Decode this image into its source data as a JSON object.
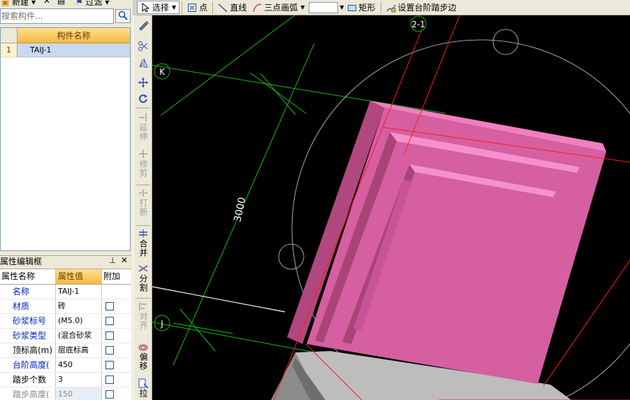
{
  "toolbar_left": {
    "new_label": "新建",
    "filter_label": "过滤"
  },
  "toolbar": {
    "select_label": "选择",
    "point_label": "点",
    "line_label": "直线",
    "arc_label": "三点画弧",
    "rect_label": "矩形",
    "step_label": "设置台阶踏步边"
  },
  "search": {
    "placeholder": "搜索构件..."
  },
  "component_list": {
    "header": "构件名称",
    "rows": [
      {
        "num": "1",
        "name": "TAIJ-1"
      }
    ]
  },
  "property_panel": {
    "title": "属性编辑框",
    "pin": "ㅁ",
    "close": "×",
    "headers": {
      "name": "属性名称",
      "value": "属性值",
      "attach": "附加"
    },
    "rows": [
      {
        "name": "名称",
        "value": "TAIJ-1",
        "style": "blue",
        "checkbox": false
      },
      {
        "name": "材质",
        "value": "砖",
        "style": "blue",
        "checkbox": true
      },
      {
        "name": "砂浆标号",
        "value": "(M5.0)",
        "style": "blue",
        "checkbox": true
      },
      {
        "name": "砂浆类型",
        "value": "(混合砂浆",
        "style": "blue",
        "checkbox": true
      },
      {
        "name": "顶标高(m)",
        "value": "层底标高",
        "style": "black",
        "checkbox": true
      },
      {
        "name": "台阶高度(",
        "value": "450",
        "style": "blue",
        "checkbox": true
      },
      {
        "name": "踏步个数",
        "value": "3",
        "style": "black",
        "checkbox": true
      },
      {
        "name": "踏步高度(",
        "value": "150",
        "style": "gray",
        "checkbox": true
      }
    ]
  },
  "vtoolbar": {
    "extend": "延伸",
    "trim": "修剪",
    "break": "打断",
    "merge": "合并",
    "split": "分割",
    "align": "对齐",
    "offset": "偏移",
    "stretch": "拉"
  },
  "canvas": {
    "axis_labels": {
      "k": "K",
      "j": "J",
      "two_one": "2-1"
    },
    "dimension": "3000"
  }
}
